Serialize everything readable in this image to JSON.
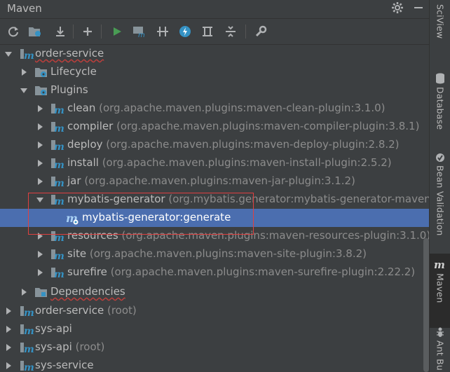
{
  "panel": {
    "title": "Maven"
  },
  "toolbar": {
    "buttons": [
      "reload-icon",
      "add-maven-project-icon",
      "download-icon",
      "add-icon",
      "run-icon",
      "execute-goal-icon",
      "toggle-offline-icon",
      "skip-tests-icon",
      "show-dependencies-icon",
      "collapse-all-icon",
      "settings-wrench-icon"
    ]
  },
  "tree": {
    "root_project": "order-service",
    "lifecycle": "Lifecycle",
    "plugins": "Plugins",
    "plugin_items": [
      {
        "name": "clean",
        "coord": "(org.apache.maven.plugins:maven-clean-plugin:3.1.0)"
      },
      {
        "name": "compiler",
        "coord": "(org.apache.maven.plugins:maven-compiler-plugin:3.8.1)"
      },
      {
        "name": "deploy",
        "coord": "(org.apache.maven.plugins:maven-deploy-plugin:2.8.2)"
      },
      {
        "name": "install",
        "coord": "(org.apache.maven.plugins:maven-install-plugin:2.5.2)"
      },
      {
        "name": "jar",
        "coord": "(org.apache.maven.plugins:maven-jar-plugin:3.1.2)"
      },
      {
        "name": "mybatis-generator",
        "coord": "(org.mybatis.generator:mybatis-generator-maven-p"
      },
      {
        "name": "resources",
        "coord": "(org.apache.maven.plugins:maven-resources-plugin:3.1.0)"
      },
      {
        "name": "site",
        "coord": "(org.apache.maven.plugins:maven-site-plugin:3.8.2)"
      },
      {
        "name": "surefire",
        "coord": "(org.apache.maven.plugins:maven-surefire-plugin:2.22.2)"
      }
    ],
    "goal": "mybatis-generator:generate",
    "dependencies": "Dependencies",
    "projects": [
      {
        "name": "order-service",
        "suffix": "(root)"
      },
      {
        "name": "sys-api",
        "suffix": ""
      },
      {
        "name": "sys-api",
        "suffix": "(root)"
      },
      {
        "name": "sys-service",
        "suffix": ""
      }
    ]
  },
  "side_tabs": {
    "sciview": "SciView",
    "database": "Database",
    "bean_validation": "Bean Validation",
    "maven": "Maven",
    "ant_build": "Ant Bu"
  },
  "colors": {
    "selection": "#4b6eaf",
    "highlight_box": "#e04040",
    "run_green": "#499c54",
    "accent_blue": "#3592c4"
  }
}
